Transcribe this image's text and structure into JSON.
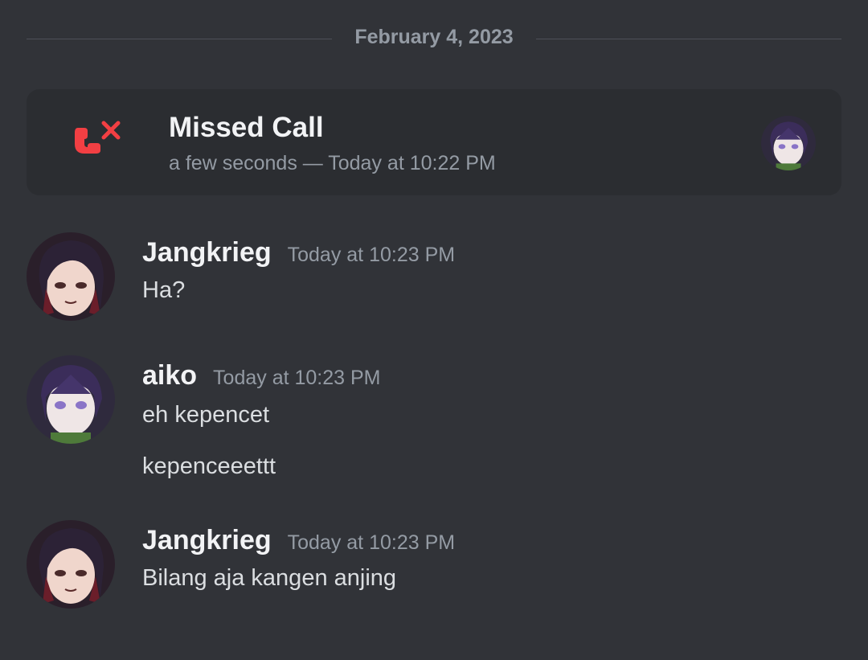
{
  "divider": {
    "date": "February 4, 2023"
  },
  "call": {
    "title": "Missed Call",
    "subtitle": "a few seconds — Today at 10:22 PM",
    "icon": "missed-call-icon",
    "accent_color": "#f23f43"
  },
  "messages": [
    {
      "username": "Jangkrieg",
      "timestamp": "Today at 10:23 PM",
      "lines": [
        "Ha?"
      ]
    },
    {
      "username": "aiko",
      "timestamp": "Today at 10:23 PM",
      "lines": [
        "eh kepencet",
        "kepenceeettt"
      ]
    },
    {
      "username": "Jangkrieg",
      "timestamp": "Today at 10:23 PM",
      "lines": [
        "Bilang aja kangen anjing"
      ]
    }
  ],
  "colors": {
    "background": "#313338",
    "card": "#2b2d31",
    "text_primary": "#f2f3f5",
    "text_muted": "#949ba4"
  }
}
